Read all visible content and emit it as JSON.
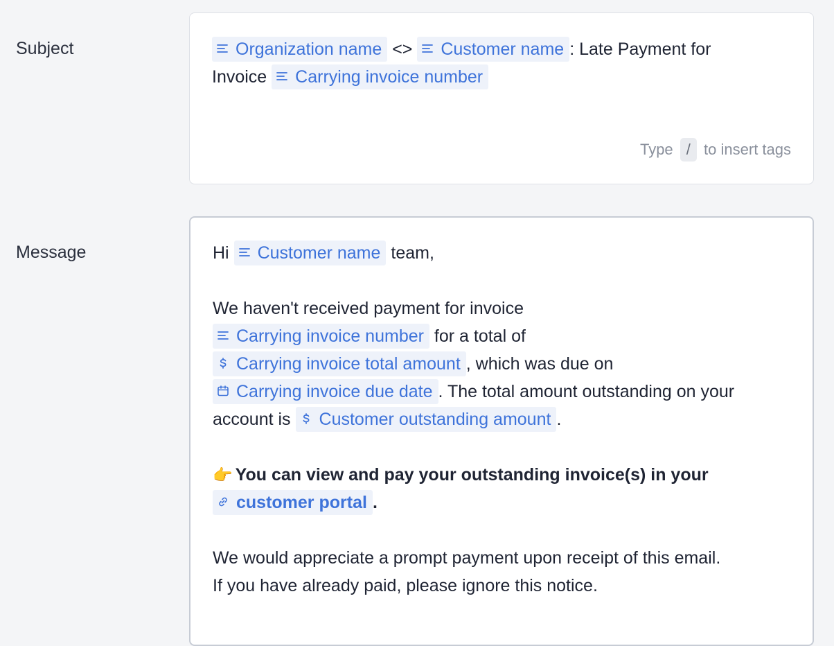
{
  "subject": {
    "label": "Subject",
    "text": {
      "separator": "<>",
      "late_payment": ": Late Payment for",
      "invoice_word": "Invoice"
    },
    "tags": {
      "org_name": "Organization name",
      "customer_name": "Customer name",
      "invoice_number": "Carrying invoice number"
    },
    "hint": {
      "prefix": "Type",
      "key": "/",
      "suffix": "to insert tags"
    }
  },
  "message": {
    "label": "Message",
    "text": {
      "hi": "Hi",
      "team": "team,",
      "p1_line1": "We haven't received payment for invoice",
      "for_total": "for a total of",
      "due_on": ", which was due on",
      "outstanding": ". The total amount outstanding on your",
      "account_is": "account is",
      "period": ".",
      "bold_line": "You can view and pay your outstanding invoice(s) in your",
      "bold_period": ".",
      "p3_line1": "We would appreciate a prompt payment upon receipt of this email.",
      "p3_line2": "If you have already paid, please ignore this notice."
    },
    "tags": {
      "customer_name": "Customer name",
      "invoice_number": "Carrying invoice number",
      "total_amount": "Carrying invoice total amount",
      "due_date": "Carrying invoice due date",
      "outstanding_amount": "Customer outstanding amount",
      "portal": "customer portal"
    },
    "emoji": "👉"
  },
  "icons": {
    "text-tag": "text-lines-icon",
    "currency-tag": "dollar-icon",
    "date-tag": "calendar-icon",
    "link-tag": "link-icon"
  },
  "colors": {
    "tag_bg": "#eef2fa",
    "tag_text": "#3e73da",
    "page_bg": "#f4f5f7"
  }
}
